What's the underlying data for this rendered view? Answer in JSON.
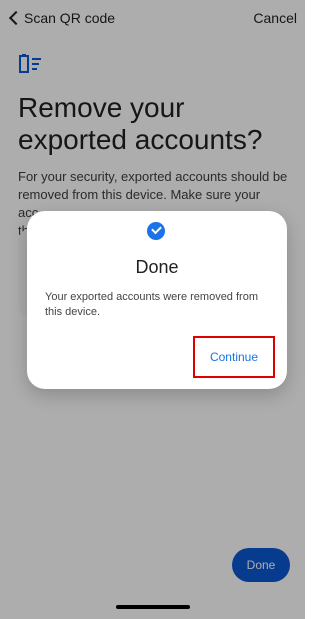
{
  "topbar": {
    "back_label": "Scan QR code",
    "cancel_label": "Cancel"
  },
  "page": {
    "title": "Remove your exported accounts?",
    "description_line1": "For your security, exported accounts should be",
    "description_line2": "removed from this device. Make sure your",
    "description_line3": "acc",
    "description_line4": "th"
  },
  "dialog": {
    "title": "Done",
    "message": "Your exported accounts were removed from this device.",
    "continue_label": "Continue"
  },
  "bottom": {
    "done_label": "Done"
  },
  "colors": {
    "accent": "#1a73e8",
    "highlight_border": "#e00000"
  },
  "icons": {
    "app": "authenticator-icon",
    "back": "chevron-left-icon",
    "check": "check-circle-icon"
  }
}
